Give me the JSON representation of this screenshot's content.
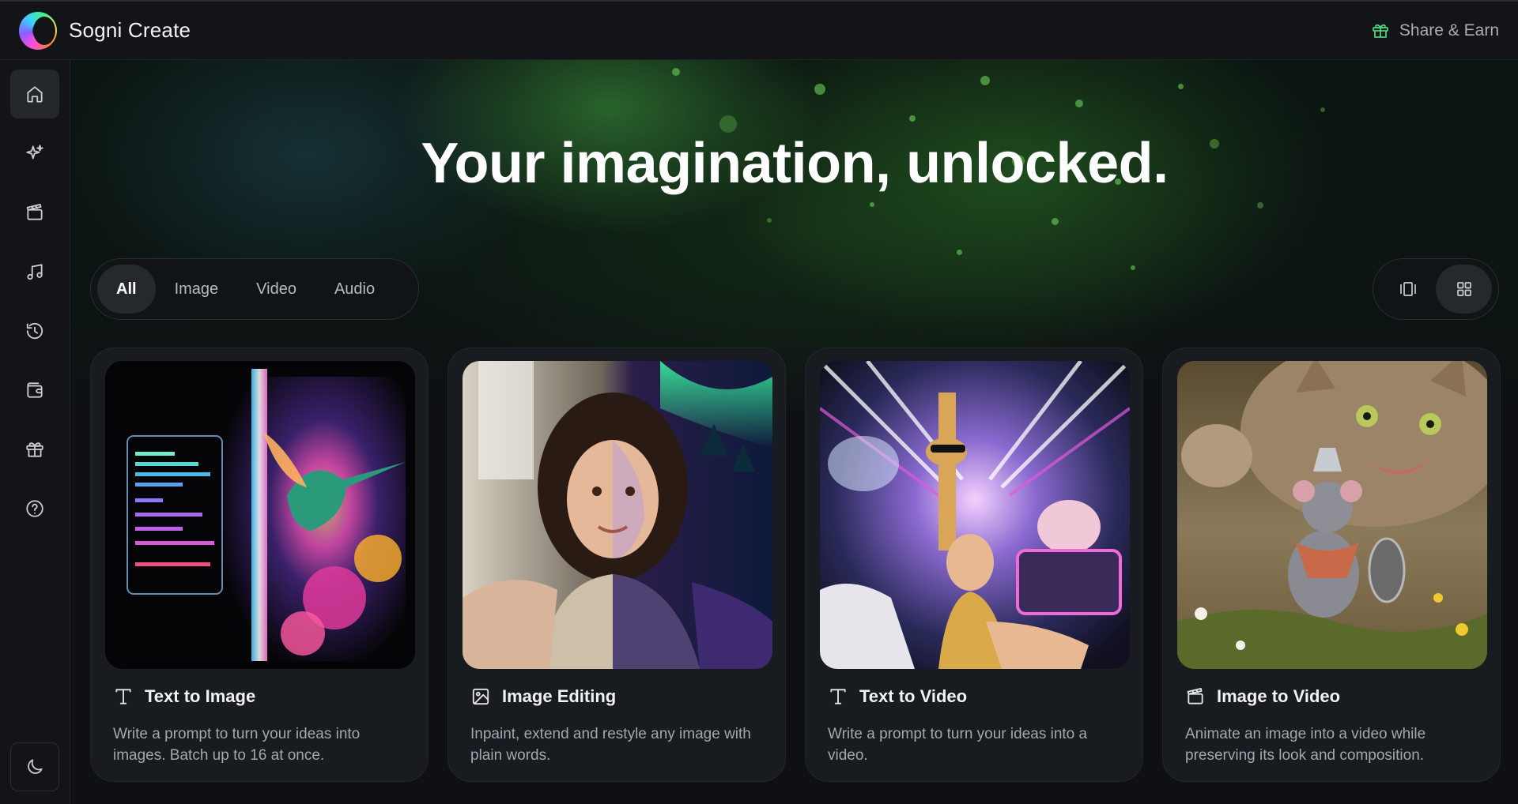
{
  "app": {
    "title": "Sogni Create"
  },
  "topbar": {
    "share_label": "Share & Earn",
    "share_icon": "gift-icon"
  },
  "sidebar": {
    "items": [
      {
        "name": "home",
        "icon": "home-icon",
        "active": true
      },
      {
        "name": "sparkle",
        "icon": "sparkle-icon",
        "active": false
      },
      {
        "name": "video",
        "icon": "clapperboard-icon",
        "active": false
      },
      {
        "name": "audio",
        "icon": "music-note-icon",
        "active": false
      },
      {
        "name": "history",
        "icon": "history-icon",
        "active": false
      },
      {
        "name": "wallet",
        "icon": "wallet-icon",
        "active": false
      },
      {
        "name": "rewards",
        "icon": "gift-icon",
        "active": false
      },
      {
        "name": "help",
        "icon": "help-icon",
        "active": false
      }
    ],
    "bottom": {
      "name": "theme-toggle",
      "icon": "moon-icon"
    }
  },
  "hero": {
    "title": "Your imagination, unlocked."
  },
  "filters": {
    "tabs": [
      {
        "label": "All",
        "active": true
      },
      {
        "label": "Image",
        "active": false
      },
      {
        "label": "Video",
        "active": false
      },
      {
        "label": "Audio",
        "active": false
      }
    ]
  },
  "view_toggle": [
    {
      "name": "carousel-view",
      "icon": "carousel-icon",
      "active": false
    },
    {
      "name": "grid-view",
      "icon": "grid-icon",
      "active": true
    }
  ],
  "cards": [
    {
      "title": "Text to Image",
      "icon": "text-icon",
      "description": "Write a prompt to turn your ideas into images. Batch up to 16 at once."
    },
    {
      "title": "Image Editing",
      "icon": "image-icon",
      "description": "Inpaint, extend and restyle any image with plain words."
    },
    {
      "title": "Text to Video",
      "icon": "text-icon",
      "description": "Write a prompt to turn your ideas into a video."
    },
    {
      "title": "Image to Video",
      "icon": "clapperboard-icon",
      "description": "Animate an image into a video while preserving its look and composition."
    }
  ],
  "colors": {
    "background": "#0d0f12",
    "panel": "#121417",
    "card": "#181b1f",
    "accent_green": "#46c46a"
  }
}
